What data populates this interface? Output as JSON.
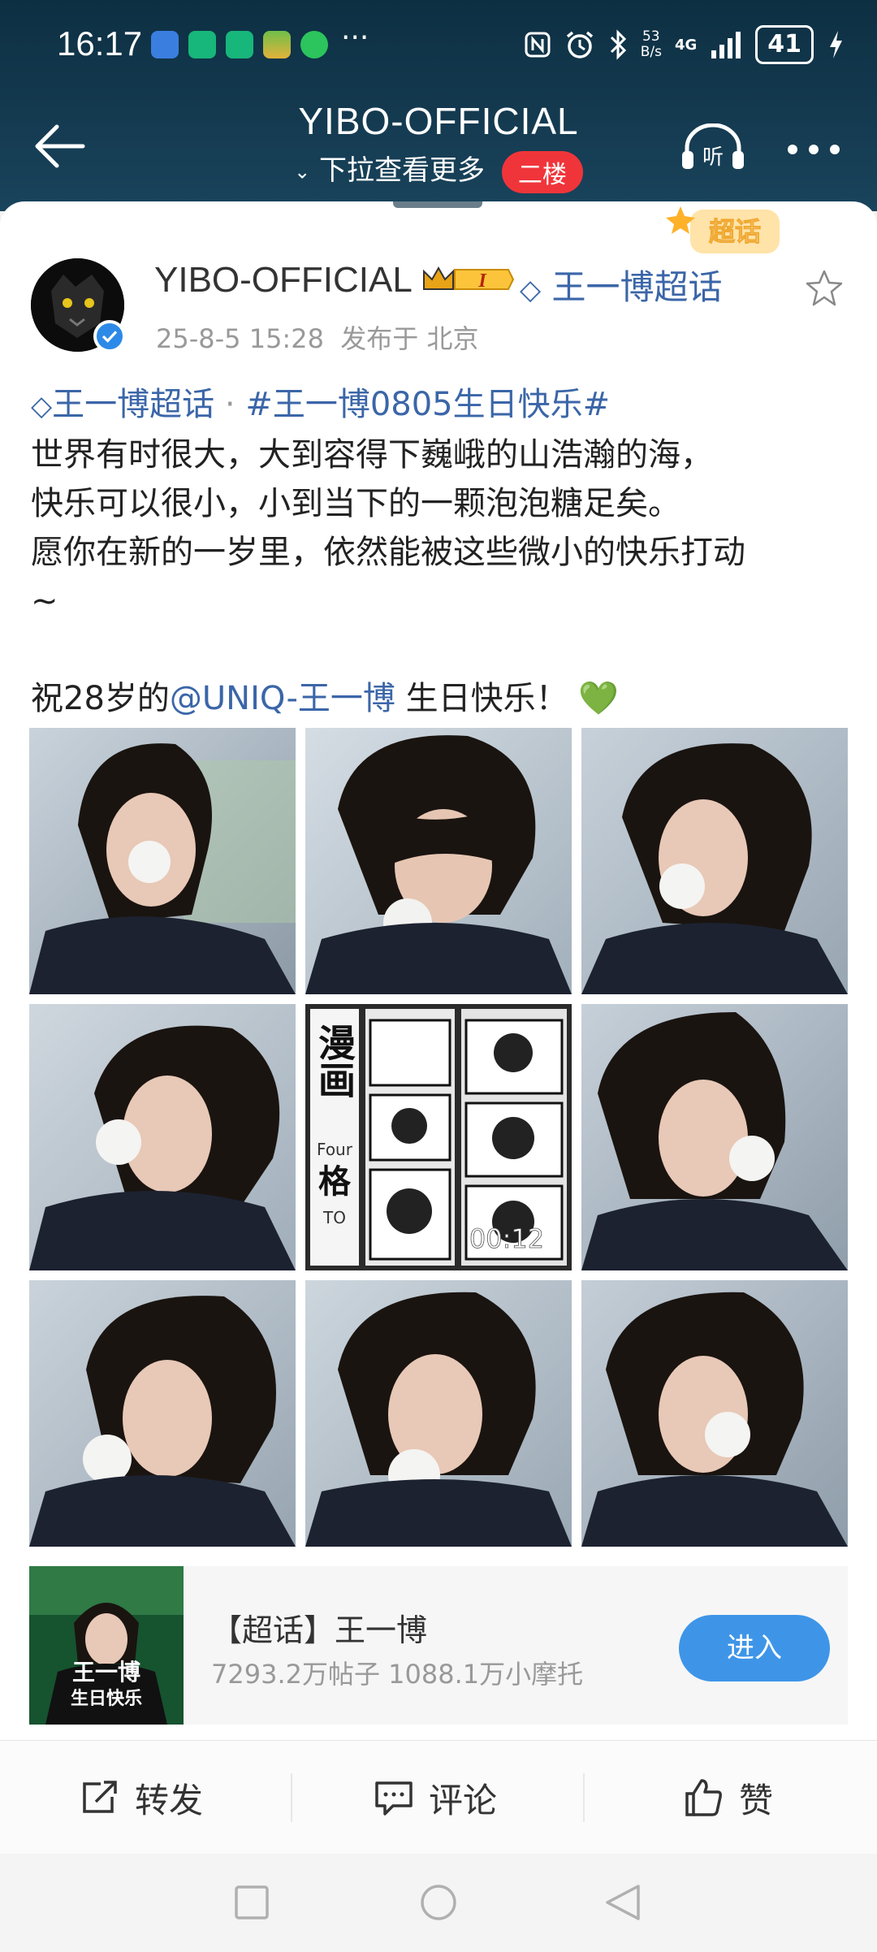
{
  "status_bar": {
    "time": "16:17",
    "overflow_dots": "···",
    "net_speed_value": "53",
    "net_speed_unit": "B/s",
    "network": "4G",
    "battery": "41",
    "icons": [
      "alarm-app-icon",
      "sport-app-icon",
      "sport-app-icon",
      "game-app-icon",
      "wechat-icon",
      "nfc-icon",
      "alarm-icon",
      "bluetooth-icon",
      "signal-icon",
      "battery-icon",
      "charging-icon"
    ]
  },
  "nav": {
    "title": "YIBO-OFFICIAL",
    "subtitle": "下拉查看更多",
    "floor_badge": "二楼",
    "listen_label": "听"
  },
  "post": {
    "badge_label": "超话",
    "author": "YIBO-OFFICIAL",
    "level": "I",
    "supertopic_link": "王一博超话",
    "timestamp": "25-8-5 15:28",
    "published_from": "发布于 北京",
    "tag_supertopic": "王一博超话",
    "tag_sep": " · ",
    "hashtag": "#王一博0805生日快乐#",
    "line1": "世界有时很大，大到容得下巍峨的山浩瀚的海，",
    "line2": "快乐可以很小，小到当下的一颗泡泡糖足矣。",
    "line3": "愿你在新的一岁里，依然能被这些微小的快乐打动",
    "line4": "~",
    "wish_prefix": "祝28岁的",
    "mention": "@UNIQ-王一博",
    "wish_suffix": " 生日快乐！",
    "heart": "💚"
  },
  "media": {
    "video_duration": "00:12",
    "comic_text": "漫画",
    "comic_four": "Four",
    "comic_grid": "格",
    "comic_to": "TO"
  },
  "supertopic_card": {
    "name": "【超话】王一博",
    "stats": "7293.2万帖子 1088.1万小摩托",
    "button": "进入",
    "poster_name": "王一博",
    "poster_line": "生日快乐"
  },
  "actions": {
    "repost": "转发",
    "comment": "评论",
    "like": "赞"
  },
  "colors": {
    "header_bg": "#143a50",
    "link": "#3b66a8",
    "floor_badge": "#f0353a",
    "enter_button": "#3e95e8",
    "verified": "#2d89e8"
  }
}
